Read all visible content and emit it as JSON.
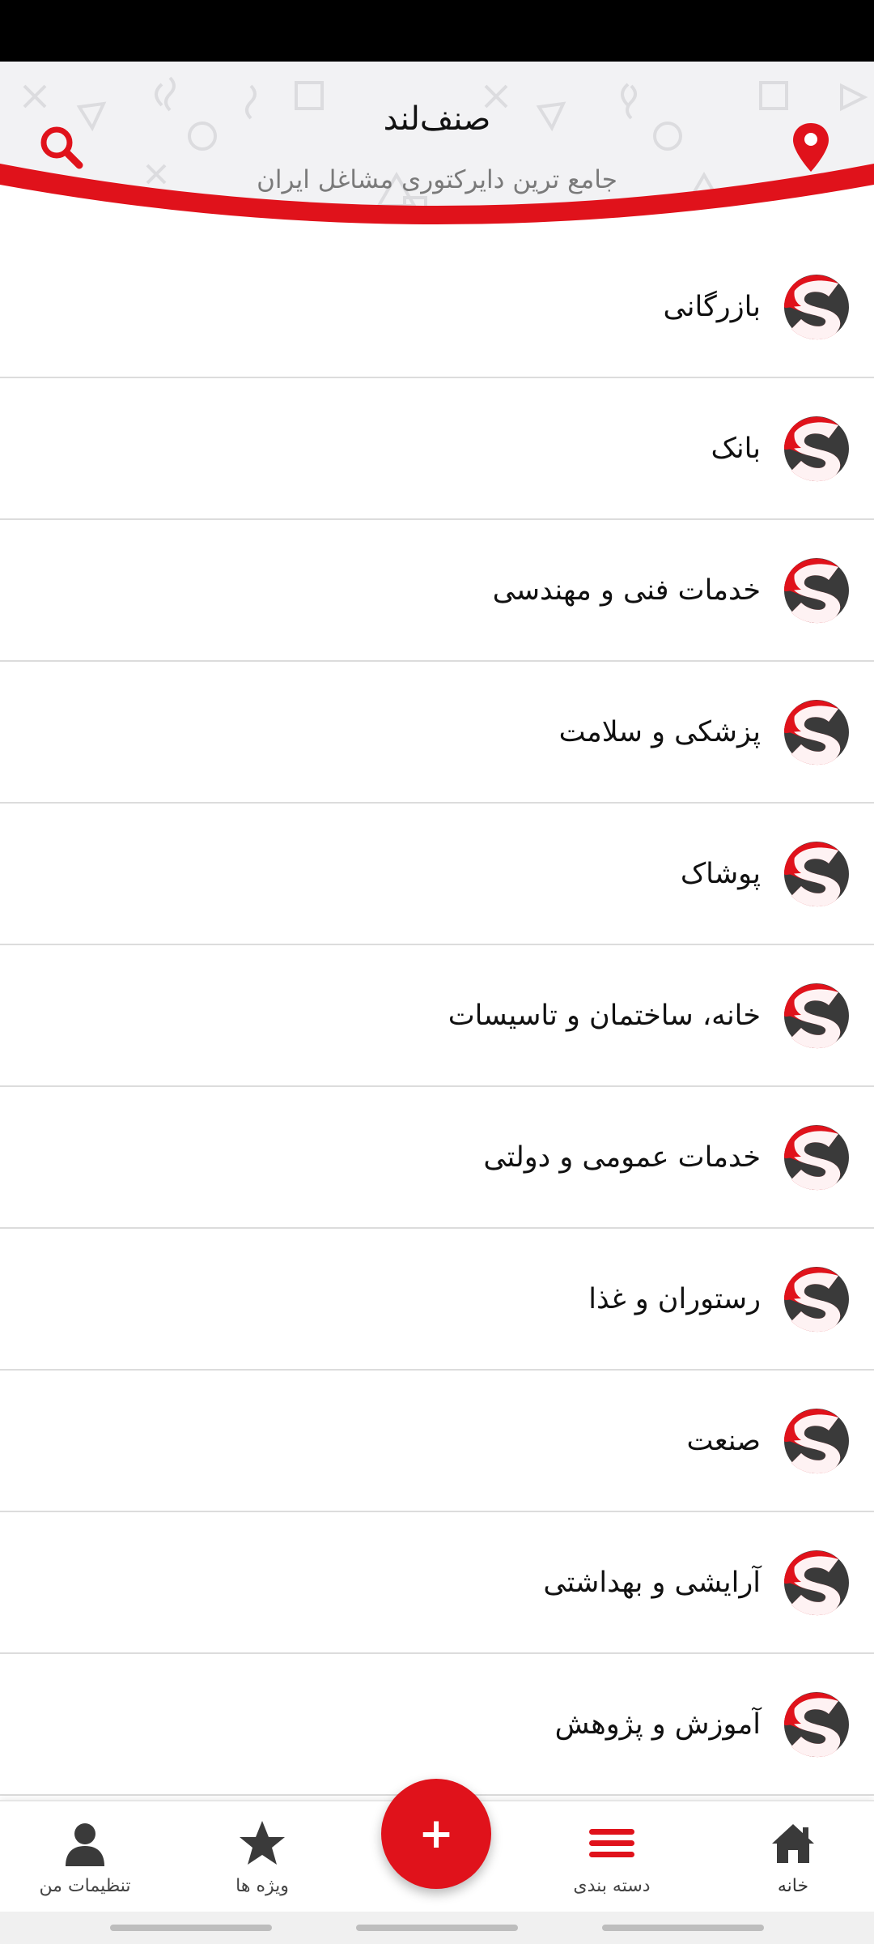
{
  "header": {
    "title": "صنف‌لند",
    "subtitle": "جامع ترین دایرکتوری مشاغل ایران",
    "search_icon": "search-icon",
    "location_icon": "location-pin-icon"
  },
  "colors": {
    "brand_red": "#e0121b",
    "logo_dark": "#3a3a3a",
    "text": "#111111",
    "subtitle": "#7a7a7a"
  },
  "categories": [
    {
      "label": "بازرگانی"
    },
    {
      "label": "بانک"
    },
    {
      "label": "خدمات فنی و مهندسی"
    },
    {
      "label": "پزشکی و سلامت"
    },
    {
      "label": "پوشاک"
    },
    {
      "label": "خانه، ساختمان و تاسیسات"
    },
    {
      "label": "خدمات عمومی و دولتی"
    },
    {
      "label": "رستوران و غذا"
    },
    {
      "label": "صنعت"
    },
    {
      "label": "آرایشی و بهداشتی"
    },
    {
      "label": "آموزش و پژوهش"
    }
  ],
  "bottom_nav": {
    "home": {
      "label": "خانه",
      "icon": "home-icon"
    },
    "categories": {
      "label": "دسته بندی",
      "icon": "list-icon"
    },
    "add": {
      "label": "+",
      "icon": "plus-icon"
    },
    "featured": {
      "label": "ویژه ها",
      "icon": "star-icon"
    },
    "settings": {
      "label": "تنظیمات من",
      "icon": "user-icon"
    }
  }
}
